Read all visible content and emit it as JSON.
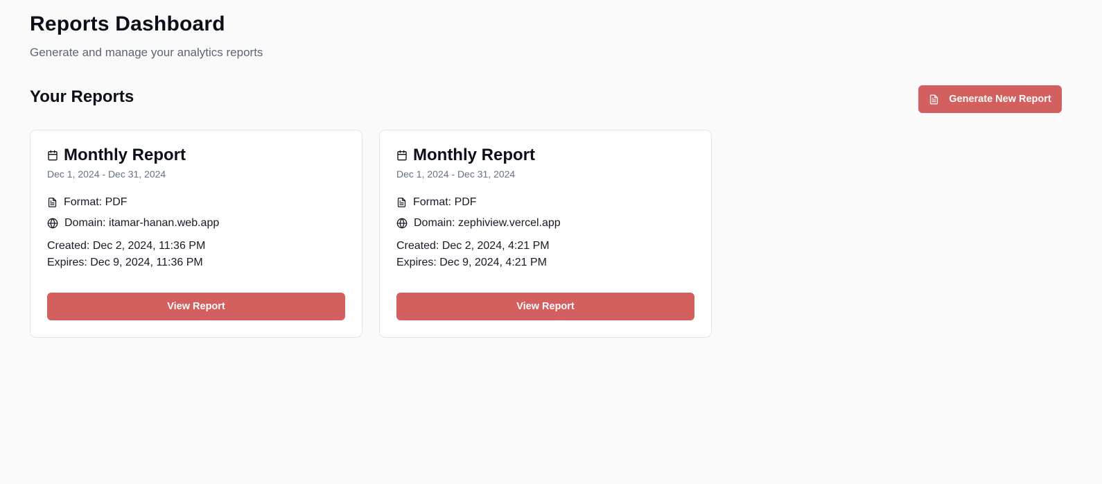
{
  "header": {
    "title": "Reports Dashboard",
    "subtitle": "Generate and manage your analytics reports"
  },
  "section": {
    "title": "Your Reports",
    "generate_label": "Generate New Report"
  },
  "colors": {
    "accent": "#d45f5f",
    "background": "#fafafa",
    "card": "#ffffff"
  },
  "reports": [
    {
      "title": "Monthly Report",
      "range": "Dec 1, 2024 - Dec 31, 2024",
      "format": "Format: PDF",
      "domain": "Domain: itamar-hanan.web.app",
      "created": "Created: Dec 2, 2024, 11:36 PM",
      "expires": "Expires: Dec 9, 2024, 11:36 PM",
      "view_label": "View Report"
    },
    {
      "title": "Monthly Report",
      "range": "Dec 1, 2024 - Dec 31, 2024",
      "format": "Format: PDF",
      "domain": "Domain: zephiview.vercel.app",
      "created": "Created: Dec 2, 2024, 4:21 PM",
      "expires": "Expires: Dec 9, 2024, 4:21 PM",
      "view_label": "View Report"
    }
  ],
  "icons": {
    "calendar": "calendar-icon",
    "file": "file-text-icon",
    "globe": "globe-icon"
  }
}
